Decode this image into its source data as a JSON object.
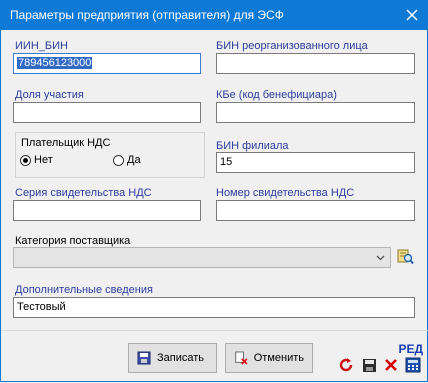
{
  "window": {
    "title": "Параметры предприятия (отправителя) для ЭСФ"
  },
  "fields": {
    "iin_bin": {
      "label": "ИИН_БИН",
      "value": "789456123000"
    },
    "bin_reorg": {
      "label": "БИН реорганизованного лица",
      "value": ""
    },
    "share": {
      "label": "Доля участия",
      "value": ""
    },
    "kbe": {
      "label": "КБе (код бенефициара)",
      "value": ""
    },
    "vat_payer": {
      "label": "Плательщик НДС",
      "options": [
        "Нет",
        "Да"
      ],
      "selected": "Нет"
    },
    "bin_branch": {
      "label": "БИН филиала",
      "value": "15"
    },
    "vat_series": {
      "label": "Серия свидетельства НДС",
      "value": ""
    },
    "vat_number": {
      "label": "Номер свидетельства  НДС",
      "value": ""
    },
    "supplier_category": {
      "label": "Категория поставщика",
      "value": ""
    },
    "extra_info": {
      "label": "Дополнительные сведения",
      "value": "Тестовый"
    }
  },
  "buttons": {
    "save": "Записать",
    "cancel": "Отменить"
  },
  "status_tag": "РЕД",
  "colors": {
    "titlebar": "#0f7ad6",
    "label_blue": "#2b3d9d",
    "selection": "#316ac5"
  }
}
